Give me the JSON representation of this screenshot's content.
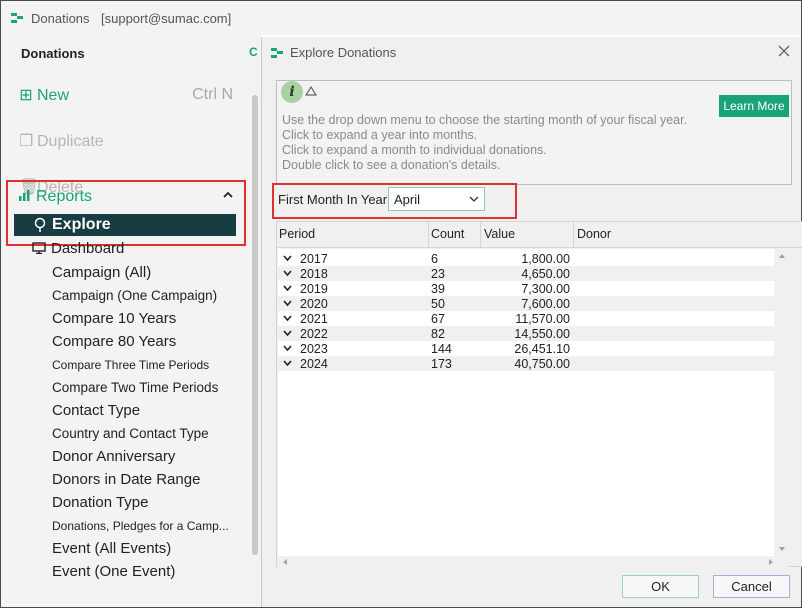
{
  "window": {
    "app_title": "Donations",
    "user": "[support@sumac.com]"
  },
  "sidebar": {
    "header": "Donations",
    "new_label": "New",
    "new_shortcut": "Ctrl N",
    "duplicate_label": "Duplicate",
    "delete_label": "Delete",
    "reports_label": "Reports",
    "explore_label": "Explore",
    "dashboard_label": "Dashboard",
    "reports": [
      "Campaign (All)",
      "Campaign (One Campaign)",
      "Compare 10 Years",
      "Compare 80 Years",
      "Compare Three Time Periods",
      "Compare Two Time Periods",
      "Contact Type",
      "Country and Contact Type",
      "Donor Anniversary",
      "Donors in Date Range",
      "Donation Type",
      "Donations, Pledges for a Camp...",
      "Event (All Events)",
      "Event (One Event)"
    ]
  },
  "dialog": {
    "title": "Explore Donations",
    "learn_more": "Learn More",
    "info_lines": [
      "Use the drop down menu to choose the starting month of your fiscal year.",
      "Click to expand a year into months.",
      "Click to expand a month to individual donations.",
      "Double click to see a donation's details."
    ],
    "first_month_label": "First Month In Year",
    "first_month_value": "April",
    "columns": [
      "Period",
      "Count",
      "Value",
      "Donor"
    ],
    "rows": [
      {
        "period": "2017",
        "count": "6",
        "value": "1,800.00"
      },
      {
        "period": "2018",
        "count": "23",
        "value": "4,650.00"
      },
      {
        "period": "2019",
        "count": "39",
        "value": "7,300.00"
      },
      {
        "period": "2020",
        "count": "50",
        "value": "7,600.00"
      },
      {
        "period": "2021",
        "count": "67",
        "value": "11,570.00"
      },
      {
        "period": "2022",
        "count": "82",
        "value": "14,550.00"
      },
      {
        "period": "2023",
        "count": "144",
        "value": "26,451.10"
      },
      {
        "period": "2024",
        "count": "173",
        "value": "40,750.00"
      }
    ],
    "ok_label": "OK",
    "cancel_label": "Cancel"
  },
  "colors": {
    "accent": "#1aa37a",
    "selection": "#173d42",
    "highlight_border": "#e03030"
  }
}
